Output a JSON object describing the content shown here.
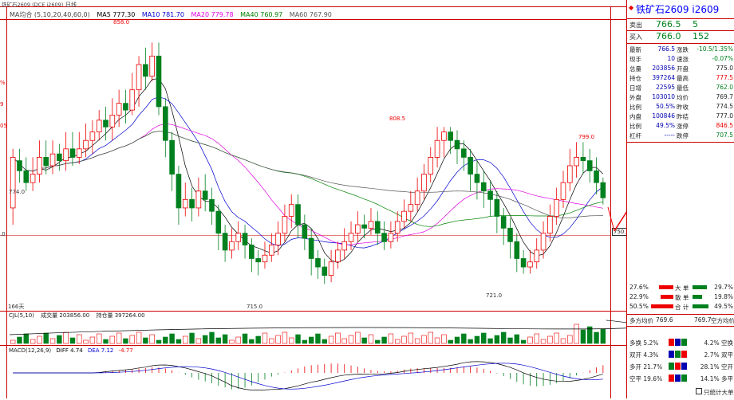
{
  "header": {
    "symbol": "铁矿石2609",
    "code": "(DCE i2609)",
    "period": "日线",
    "ma_label": "MA均合 (5,10,20,40,60,0)",
    "ma5": "MA5 777.30",
    "ma10": "MA10 781.70",
    "ma20": "MA20 779.78",
    "ma40": "MA40 760.97",
    "ma60": "MA60 767.90"
  },
  "price_annotations": {
    "high1": "858.0",
    "low_left": "774.0",
    "high2": "808.5",
    "low1": "715.0",
    "low2": "721.0",
    "high3": "799.0",
    "current": "750.1",
    "days": "166天"
  },
  "left_axis": [
    "%",
    "9",
    "05",
    ".0"
  ],
  "volume": {
    "label": "CJL",
    "params": "(5,10)",
    "text": "成交量 203856.00",
    "hold": "持仓量 397264.00"
  },
  "macd": {
    "label": "MACD(12,26,9)",
    "diff": "DIFF 4.74",
    "dea": "DEA 7.12",
    "macd": "-4.77"
  },
  "panel": {
    "title": "铁矿石2609",
    "title_code": "i2609",
    "sell_label": "卖出",
    "sell_price": "766.5",
    "sell_vol": "5",
    "buy_label": "买入",
    "buy_price": "766.0",
    "buy_vol": "152",
    "rows": [
      [
        "最新",
        "766.5",
        "涨跌",
        "-10.5/1.35%"
      ],
      [
        "现手",
        "10",
        "速涨",
        "-0.07%"
      ],
      [
        "总量",
        "203856",
        "开盘",
        "775.0"
      ],
      [
        "持仓",
        "397264",
        "最高",
        "777.5"
      ],
      [
        "日增",
        "22595",
        "最低",
        "762.0"
      ],
      [
        "外盘",
        "103010",
        "均价",
        "769.7"
      ],
      [
        "比例",
        "50.5%",
        "昨收",
        "774.5"
      ],
      [
        "内盘",
        "100846",
        "昨结",
        "777.0"
      ],
      [
        "比例",
        "49.5%",
        "涨停",
        "846.5"
      ],
      [
        "杠杆",
        "-----",
        "跌停",
        "707.5"
      ]
    ],
    "flow": [
      [
        "27.6%",
        "大 单",
        "29.7%"
      ],
      [
        "22.9%",
        "散 单",
        "19.8%"
      ],
      [
        "50.5%",
        "合 计",
        "49.5%"
      ]
    ],
    "avg_label_left": "多方均价",
    "avg_left": "769.6",
    "avg_right": "769.7",
    "avg_label_right": "空方均价",
    "stats": [
      [
        "多换",
        "5.2%",
        "4.2%",
        "空换"
      ],
      [
        "双开",
        "4.3%",
        "2.7%",
        "双平"
      ],
      [
        "多开",
        "21.7%",
        "28.1%",
        "空开"
      ],
      [
        "空平",
        "19.6%",
        "14.1%",
        "多平"
      ]
    ],
    "checkbox_label": "只统计大单"
  },
  "chart_data": {
    "type": "candlestick",
    "candles": [
      [
        760,
        790,
        750,
        795
      ],
      [
        788,
        782,
        775,
        795
      ],
      [
        782,
        775,
        770,
        790
      ],
      [
        775,
        780,
        770,
        790
      ],
      [
        780,
        790,
        775,
        800
      ],
      [
        790,
        785,
        780,
        800
      ],
      [
        785,
        792,
        780,
        800
      ],
      [
        792,
        788,
        782,
        798
      ],
      [
        788,
        795,
        782,
        805
      ],
      [
        795,
        790,
        785,
        805
      ],
      [
        790,
        795,
        786,
        805
      ],
      [
        795,
        800,
        790,
        810
      ],
      [
        800,
        805,
        792,
        812
      ],
      [
        805,
        812,
        800,
        818
      ],
      [
        812,
        808,
        800,
        820
      ],
      [
        808,
        815,
        800,
        825
      ],
      [
        815,
        822,
        808,
        830
      ],
      [
        822,
        818,
        810,
        830
      ],
      [
        818,
        830,
        815,
        840
      ],
      [
        830,
        845,
        820,
        850
      ],
      [
        845,
        838,
        830,
        855
      ],
      [
        838,
        850,
        835,
        858
      ],
      [
        850,
        820,
        815,
        858
      ],
      [
        820,
        800,
        790,
        825
      ],
      [
        800,
        780,
        770,
        805
      ],
      [
        780,
        760,
        750,
        785
      ],
      [
        760,
        765,
        755,
        775
      ],
      [
        765,
        760,
        752,
        772
      ],
      [
        760,
        770,
        755,
        778
      ],
      [
        770,
        765,
        758,
        780
      ],
      [
        765,
        758,
        750,
        772
      ],
      [
        758,
        745,
        735,
        762
      ],
      [
        745,
        735,
        728,
        750
      ],
      [
        735,
        740,
        730,
        748
      ],
      [
        740,
        745,
        735,
        752
      ],
      [
        745,
        738,
        730,
        750
      ],
      [
        738,
        730,
        722,
        742
      ],
      [
        730,
        728,
        720,
        735
      ],
      [
        728,
        732,
        724,
        740
      ],
      [
        732,
        738,
        728,
        745
      ],
      [
        738,
        745,
        732,
        752
      ],
      [
        745,
        755,
        740,
        762
      ],
      [
        755,
        762,
        748,
        768
      ],
      [
        762,
        750,
        742,
        768
      ],
      [
        750,
        742,
        735,
        756
      ],
      [
        742,
        730,
        720,
        748
      ],
      [
        730,
        725,
        718,
        735
      ],
      [
        725,
        720,
        715,
        730
      ],
      [
        720,
        728,
        716,
        735
      ],
      [
        728,
        735,
        724,
        740
      ],
      [
        735,
        740,
        730,
        748
      ],
      [
        740,
        745,
        735,
        752
      ],
      [
        745,
        750,
        740,
        758
      ],
      [
        750,
        748,
        742,
        756
      ],
      [
        748,
        752,
        744,
        760
      ],
      [
        752,
        745,
        738,
        758
      ],
      [
        745,
        740,
        735,
        752
      ],
      [
        740,
        745,
        736,
        752
      ],
      [
        745,
        752,
        740,
        758
      ],
      [
        752,
        758,
        748,
        765
      ],
      [
        758,
        762,
        752,
        770
      ],
      [
        762,
        770,
        758,
        778
      ],
      [
        770,
        780,
        765,
        786
      ],
      [
        780,
        790,
        775,
        796
      ],
      [
        790,
        800,
        784,
        808
      ],
      [
        800,
        805,
        790,
        808
      ],
      [
        805,
        800,
        792,
        808
      ],
      [
        800,
        795,
        786,
        806
      ],
      [
        795,
        790,
        782,
        800
      ],
      [
        790,
        780,
        770,
        795
      ],
      [
        780,
        775,
        765,
        788
      ],
      [
        775,
        770,
        760,
        782
      ],
      [
        770,
        765,
        755,
        776
      ],
      [
        765,
        755,
        745,
        770
      ],
      [
        755,
        748,
        738,
        760
      ],
      [
        748,
        740,
        730,
        754
      ],
      [
        740,
        730,
        722,
        745
      ],
      [
        730,
        725,
        721,
        735
      ],
      [
        725,
        728,
        721,
        735
      ],
      [
        728,
        735,
        724,
        742
      ],
      [
        735,
        745,
        730,
        752
      ],
      [
        745,
        755,
        740,
        762
      ],
      [
        755,
        765,
        750,
        772
      ],
      [
        765,
        775,
        760,
        782
      ],
      [
        775,
        785,
        770,
        795
      ],
      [
        785,
        790,
        778,
        799
      ],
      [
        790,
        788,
        780,
        799
      ],
      [
        788,
        782,
        775,
        795
      ],
      [
        782,
        775,
        768,
        790
      ],
      [
        775,
        766,
        762,
        778
      ]
    ],
    "ylim": [
      700,
      870
    ]
  }
}
